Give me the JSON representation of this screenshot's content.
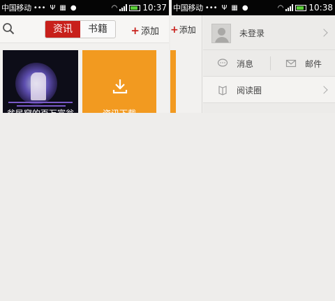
{
  "status_left": {
    "carrier": "中国移动",
    "dots": "•••",
    "time": "10:37"
  },
  "status_right": {
    "carrier": "中国移动",
    "dots": "•••",
    "time": "10:38"
  },
  "toolbar": {
    "tabs": [
      {
        "label": "资讯",
        "active": true
      },
      {
        "label": "书籍",
        "active": false
      }
    ],
    "add_label": "添加",
    "add_symbol": "+"
  },
  "tiles": [
    {
      "caption": "贫民窟的百万富翁",
      "kind": "poster"
    },
    {
      "caption": "资讯下载",
      "kind": "download"
    }
  ],
  "side_menu": {
    "user": "未登录",
    "messages": "消息",
    "mail": "邮件",
    "circle": "阅读圈"
  },
  "colors": {
    "accent_red": "#c8201b",
    "tile_orange": "#f29a20",
    "statusbar": "#050505"
  }
}
